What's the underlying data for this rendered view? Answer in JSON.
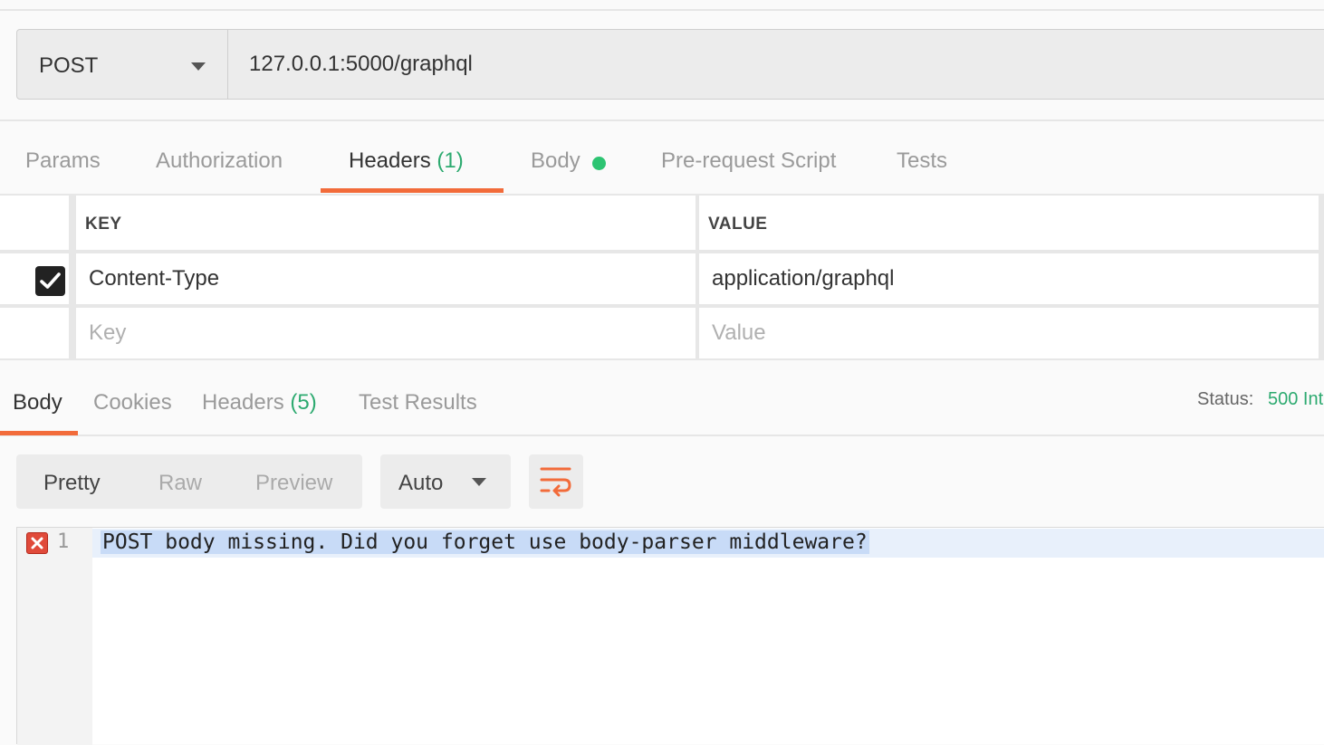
{
  "request": {
    "method": "POST",
    "url": "127.0.0.1:5000/graphql"
  },
  "request_tabs": {
    "params": "Params",
    "authorization": "Authorization",
    "headers": "Headers",
    "headers_count": "(1)",
    "body": "Body",
    "pre_request": "Pre-request Script",
    "tests": "Tests"
  },
  "headers_table": {
    "key_header": "KEY",
    "value_header": "VALUE",
    "rows": [
      {
        "key": "Content-Type",
        "value": "application/graphql",
        "checked": true
      }
    ],
    "key_placeholder": "Key",
    "value_placeholder": "Value"
  },
  "response_tabs": {
    "body": "Body",
    "cookies": "Cookies",
    "headers": "Headers",
    "headers_count": "(5)",
    "test_results": "Test Results"
  },
  "status": {
    "label": "Status:",
    "value": "500 Int"
  },
  "response_toolbar": {
    "pretty": "Pretty",
    "raw": "Raw",
    "preview": "Preview",
    "language": "Auto",
    "wrap_icon": "wrap-lines-icon"
  },
  "editor": {
    "line_number": "1",
    "line_text": "POST body missing. Did you forget use body-parser middleware?",
    "error_icon": "error-icon"
  },
  "colors": {
    "accent": "#f26b3a",
    "success": "#2daa70",
    "dot": "#2dc472",
    "error": "#e04a3a"
  }
}
